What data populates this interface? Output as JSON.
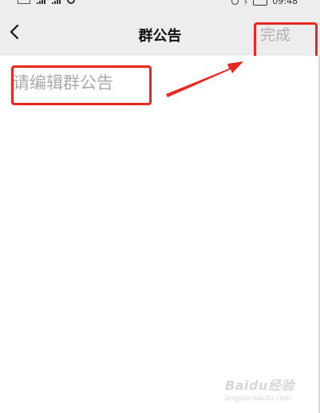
{
  "status_bar": {
    "time": "09:48",
    "icons": [
      "sim-icon",
      "signal-icon",
      "signal-icon",
      "wifi-icon",
      "alarm-icon",
      "bluetooth-icon",
      "battery-icon"
    ]
  },
  "header": {
    "back_icon": "chevron-left-icon",
    "title": "群公告",
    "done_label": "完成",
    "done_color": "#b0b0b0"
  },
  "editor": {
    "placeholder": "请编辑群公告",
    "value": ""
  },
  "annotations": {
    "highlight_color": "#e8271f"
  },
  "watermark": {
    "brand": "Baidu经验",
    "url": "jingyan.baidu.com"
  }
}
